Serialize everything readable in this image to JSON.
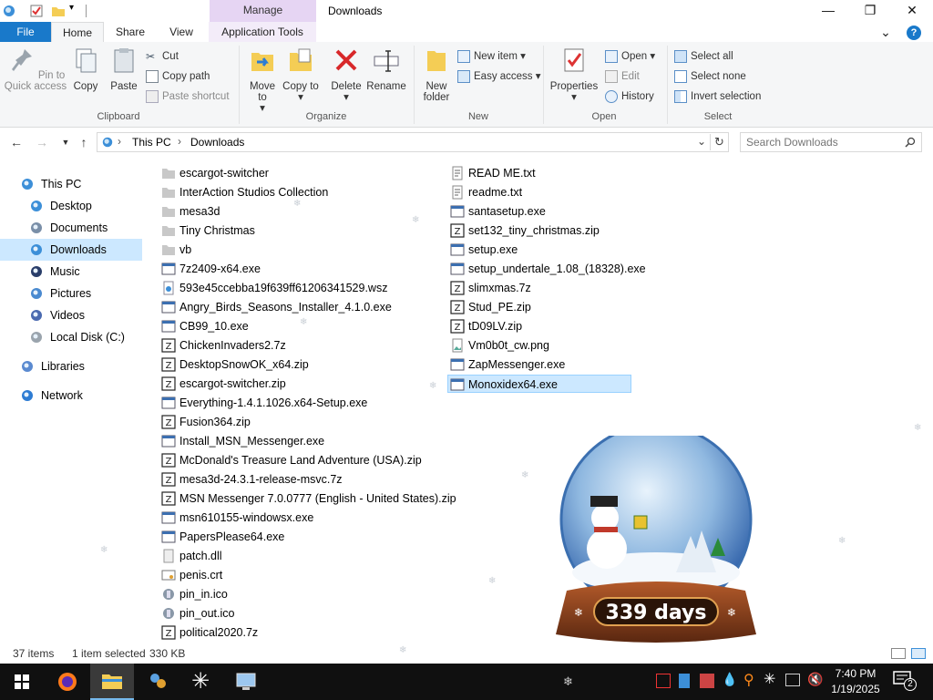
{
  "window": {
    "title": "Downloads",
    "manage_tab": "Manage",
    "minimize": "—",
    "maximize": "❐",
    "close": "✕"
  },
  "ribbon_tabs": {
    "file": "File",
    "home": "Home",
    "share": "Share",
    "view": "View",
    "application_tools": "Application Tools",
    "expand": "⌄",
    "help": "?"
  },
  "ribbon": {
    "clipboard": {
      "label": "Clipboard",
      "pin_quick_access": "Pin to Quick access",
      "copy": "Copy",
      "paste": "Paste",
      "cut": "Cut",
      "copy_path": "Copy path",
      "paste_shortcut": "Paste shortcut"
    },
    "organize": {
      "label": "Organize",
      "move_to": "Move to",
      "copy_to": "Copy to",
      "delete": "Delete",
      "rename": "Rename"
    },
    "new": {
      "label": "New",
      "new_folder": "New folder",
      "new_item": "New item",
      "easy_access": "Easy access"
    },
    "open": {
      "label": "Open",
      "properties": "Properties",
      "open": "Open",
      "edit": "Edit",
      "history": "History"
    },
    "select": {
      "label": "Select",
      "select_all": "Select all",
      "select_none": "Select none",
      "invert_selection": "Invert selection"
    }
  },
  "address": {
    "crumb_root": "This PC",
    "crumb_current": "Downloads",
    "separator": "›",
    "search_placeholder": "Search Downloads"
  },
  "nav_pane": {
    "items": [
      {
        "label": "This PC",
        "icon": "this-pc-icon"
      },
      {
        "label": "Desktop",
        "icon": "desktop-icon"
      },
      {
        "label": "Documents",
        "icon": "documents-icon"
      },
      {
        "label": "Downloads",
        "icon": "downloads-icon",
        "selected": true
      },
      {
        "label": "Music",
        "icon": "music-icon"
      },
      {
        "label": "Pictures",
        "icon": "pictures-icon"
      },
      {
        "label": "Videos",
        "icon": "videos-icon"
      },
      {
        "label": "Local Disk (C:)",
        "icon": "local-disk-icon"
      },
      {
        "label": "Libraries",
        "icon": "libraries-icon"
      },
      {
        "label": "Network",
        "icon": "network-icon"
      }
    ]
  },
  "files": {
    "column1": [
      {
        "name": "escargot-switcher",
        "type": "folder"
      },
      {
        "name": "InterAction Studios Collection",
        "type": "folder"
      },
      {
        "name": "mesa3d",
        "type": "folder"
      },
      {
        "name": "Tiny Christmas",
        "type": "folder"
      },
      {
        "name": "vb",
        "type": "folder"
      },
      {
        "name": "7z2409-x64.exe",
        "type": "exe"
      },
      {
        "name": "593e45ccebba19f639ff61206341529.wsz",
        "type": "wsz"
      },
      {
        "name": "Angry_Birds_Seasons_Installer_4.1.0.exe",
        "type": "exe"
      },
      {
        "name": "CB99_10.exe",
        "type": "exe"
      },
      {
        "name": "ChickenInvaders2.7z",
        "type": "archive"
      },
      {
        "name": "DesktopSnowOK_x64.zip",
        "type": "archive"
      },
      {
        "name": "escargot-switcher.zip",
        "type": "archive"
      },
      {
        "name": "Everything-1.4.1.1026.x64-Setup.exe",
        "type": "exe"
      },
      {
        "name": "Fusion364.zip",
        "type": "archive"
      },
      {
        "name": "Install_MSN_Messenger.exe",
        "type": "exe"
      },
      {
        "name": "McDonald's Treasure Land Adventure (USA).zip",
        "type": "archive"
      },
      {
        "name": "mesa3d-24.3.1-release-msvc.7z",
        "type": "archive"
      },
      {
        "name": "MSN Messenger 7.0.0777 (English - United States).zip",
        "type": "archive"
      },
      {
        "name": "msn610155-windowsx.exe",
        "type": "exe"
      },
      {
        "name": "PapersPlease64.exe",
        "type": "exe"
      },
      {
        "name": "patch.dll",
        "type": "dll"
      },
      {
        "name": "penis.crt",
        "type": "crt"
      },
      {
        "name": "pin_in.ico",
        "type": "ico"
      },
      {
        "name": "pin_out.ico",
        "type": "ico"
      },
      {
        "name": "political2020.7z",
        "type": "archive"
      }
    ],
    "column2": [
      {
        "name": "READ ME.txt",
        "type": "txt"
      },
      {
        "name": "readme.txt",
        "type": "txt"
      },
      {
        "name": "santasetup.exe",
        "type": "exe"
      },
      {
        "name": "set132_tiny_christmas.zip",
        "type": "archive"
      },
      {
        "name": "setup.exe",
        "type": "exe"
      },
      {
        "name": "setup_undertale_1.08_(18328).exe",
        "type": "exe"
      },
      {
        "name": "slimxmas.7z",
        "type": "archive"
      },
      {
        "name": "Stud_PE.zip",
        "type": "archive"
      },
      {
        "name": "tD09LV.zip",
        "type": "archive"
      },
      {
        "name": "Vm0b0t_cw.png",
        "type": "png"
      },
      {
        "name": "ZapMessenger.exe",
        "type": "exe"
      },
      {
        "name": "Monoxidex64.exe",
        "type": "exe",
        "selected": true
      }
    ]
  },
  "status": {
    "item_count": "37 items",
    "selection": "1 item selected",
    "size": "330 KB"
  },
  "snowglobe": {
    "days_text": "339 days"
  },
  "taskbar": {
    "time": "7:40 PM",
    "date": "1/19/2025",
    "notification_count": "2"
  },
  "colors": {
    "file_tab": "#1979ca",
    "selection": "#cce8ff",
    "manage_tab": "#e6d5f3",
    "taskbar": "#101010"
  }
}
